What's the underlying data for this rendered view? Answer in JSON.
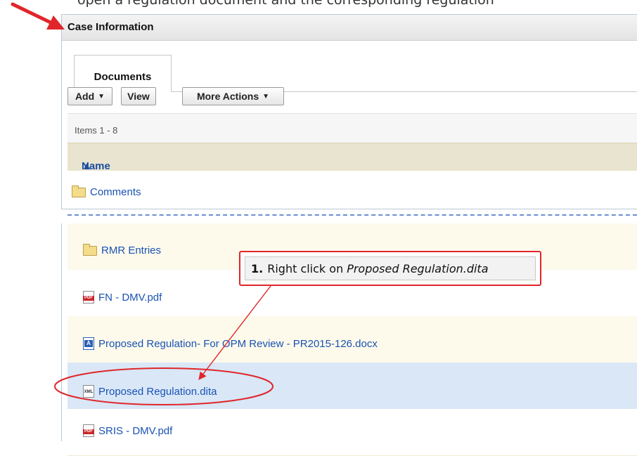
{
  "clipped_text": "open a regulation document and the corresponding regulation",
  "panel": {
    "title": "Case Information",
    "tab": "Documents",
    "toolbar": {
      "add_label": "Add",
      "view_label": "View",
      "more_actions_label": "More Actions"
    },
    "items_count": "Items 1 - 8",
    "column_header": "Name"
  },
  "rows": [
    {
      "name": "Comments",
      "icon": "folder-icon"
    },
    {
      "name": "RMR Entries",
      "icon": "folder-icon"
    },
    {
      "name": "FN - DMV.pdf",
      "icon": "pdf-icon"
    },
    {
      "name": "Proposed Regulation- For OPM Review - PR2015-126.docx",
      "icon": "docx-icon"
    },
    {
      "name": "Proposed Regulation.dita",
      "icon": "xml-icon"
    },
    {
      "name": "SRIS - DMV.pdf",
      "icon": "pdf-icon"
    }
  ],
  "icon_labels": {
    "pdf": "PDF",
    "docx": "A",
    "xml": "XML"
  },
  "callout": {
    "step": "1.",
    "text": "Right click on",
    "target": "Proposed Regulation.dita"
  },
  "colors": {
    "annotation_red": "#e0262a",
    "link_blue": "#1a52b3",
    "selected_row": "#d9e7f7",
    "header_tan": "#e9e4cf"
  }
}
